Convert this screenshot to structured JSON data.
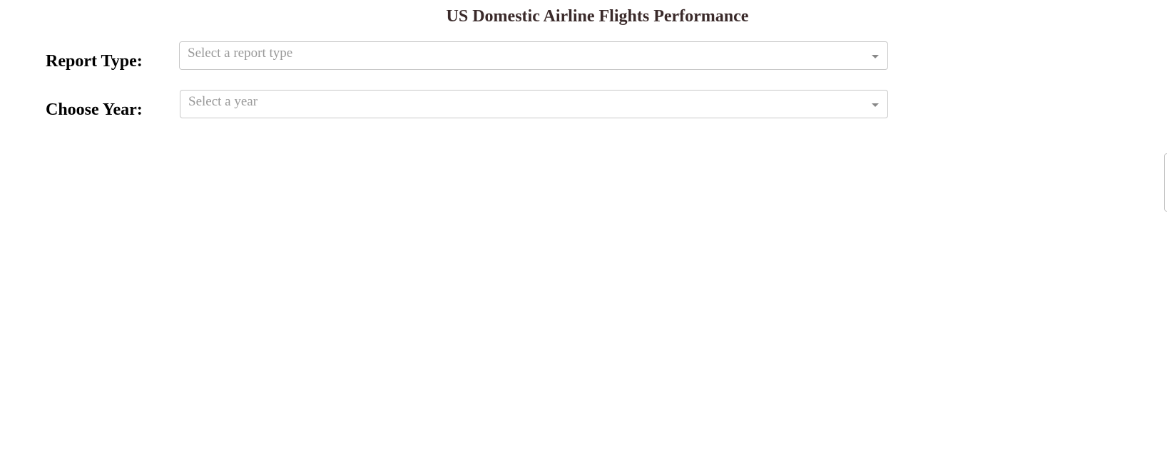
{
  "page": {
    "title": "US Domestic Airline Flights Performance"
  },
  "form": {
    "report_type": {
      "label": "Report Type:",
      "placeholder": "Select a report type",
      "icon": "chevron-down-icon"
    },
    "year": {
      "label": "Choose Year:",
      "placeholder": "Select a year",
      "icon": "chevron-down-icon"
    }
  },
  "colors": {
    "title": "#3a2a2a",
    "label": "#000000",
    "placeholder": "#999999",
    "border": "#c8c8c8",
    "caret": "#888888",
    "background": "#ffffff"
  }
}
